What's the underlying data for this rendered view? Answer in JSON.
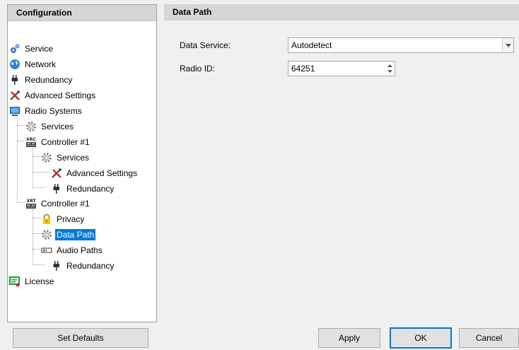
{
  "left_panel": {
    "title": "Configuration",
    "tree": [
      {
        "label": "Service",
        "icon": "gears-icon"
      },
      {
        "label": "Network",
        "icon": "globe-icon"
      },
      {
        "label": "Redundancy",
        "icon": "plug-icon"
      },
      {
        "label": "Advanced Settings",
        "icon": "tools-icon"
      },
      {
        "label": "Radio Systems",
        "icon": "monitor-icon"
      },
      {
        "label": "Services",
        "icon": "gear-icon"
      },
      {
        "label": "Controller #1",
        "icon": "xrc-controller-icon",
        "icon_text": "XRC"
      },
      {
        "label": "Services",
        "icon": "gear-icon"
      },
      {
        "label": "Advanced Settings",
        "icon": "tools-icon"
      },
      {
        "label": "Redundancy",
        "icon": "plug-icon"
      },
      {
        "label": "Controller #1",
        "icon": "xrt-controller-icon",
        "icon_text": "XRT"
      },
      {
        "label": "Privacy",
        "icon": "lock-icon"
      },
      {
        "label": "Data Path",
        "icon": "gear-icon",
        "selected": true
      },
      {
        "label": "Audio Paths",
        "icon": "audio-path-icon"
      },
      {
        "label": "Redundancy",
        "icon": "plug-icon"
      },
      {
        "label": "License",
        "icon": "license-icon"
      }
    ]
  },
  "right_panel": {
    "title": "Data Path",
    "data_service": {
      "label": "Data Service:",
      "value": "Autodetect"
    },
    "radio_id": {
      "label": "Radio ID:",
      "value": "64251"
    }
  },
  "buttons": {
    "set_defaults": "Set Defaults",
    "apply": "Apply",
    "ok": "OK",
    "cancel": "Cancel"
  },
  "colors": {
    "selection": "#0078d7",
    "header_bg": "#d6d6d6"
  }
}
